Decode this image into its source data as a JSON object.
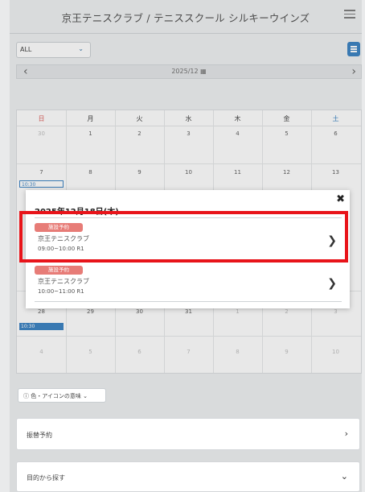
{
  "header": {
    "title": "京王テニスクラブ / テニススクール シルキーウインズ"
  },
  "filter": {
    "value": "ALL"
  },
  "month": {
    "label": "2025/12"
  },
  "calendar": {
    "weekdays": [
      "日",
      "月",
      "火",
      "水",
      "木",
      "金",
      "土"
    ],
    "week1": [
      "30",
      "1",
      "2",
      "3",
      "4",
      "5",
      "6"
    ],
    "week2": [
      "7",
      "8",
      "9",
      "10",
      "11",
      "12",
      "13"
    ],
    "week4_visible": [
      "28",
      "29",
      "30",
      "31",
      "1",
      "2",
      "3"
    ],
    "week5": [
      "4",
      "5",
      "6",
      "7",
      "8",
      "9",
      "10"
    ],
    "chip_week2": "10:30 ",
    "chip_week4": "10:30"
  },
  "dialog": {
    "date": "2025年12月18日(木)",
    "items": [
      {
        "badge": "施設予約",
        "club": "京王テニスクラブ",
        "time": "09:00~10:00  R1"
      },
      {
        "badge": "施設予約",
        "club": "京王テニスクラブ",
        "time": "10:00~11:00  R1"
      }
    ]
  },
  "legend": {
    "label": "色・アイコンの意味"
  },
  "panels": {
    "transfer": "振替予約",
    "purpose": "目的から探す"
  },
  "colors": {
    "accent": "#2f7bbf",
    "badge": "#e77c77",
    "highlight": "#e8141a"
  }
}
